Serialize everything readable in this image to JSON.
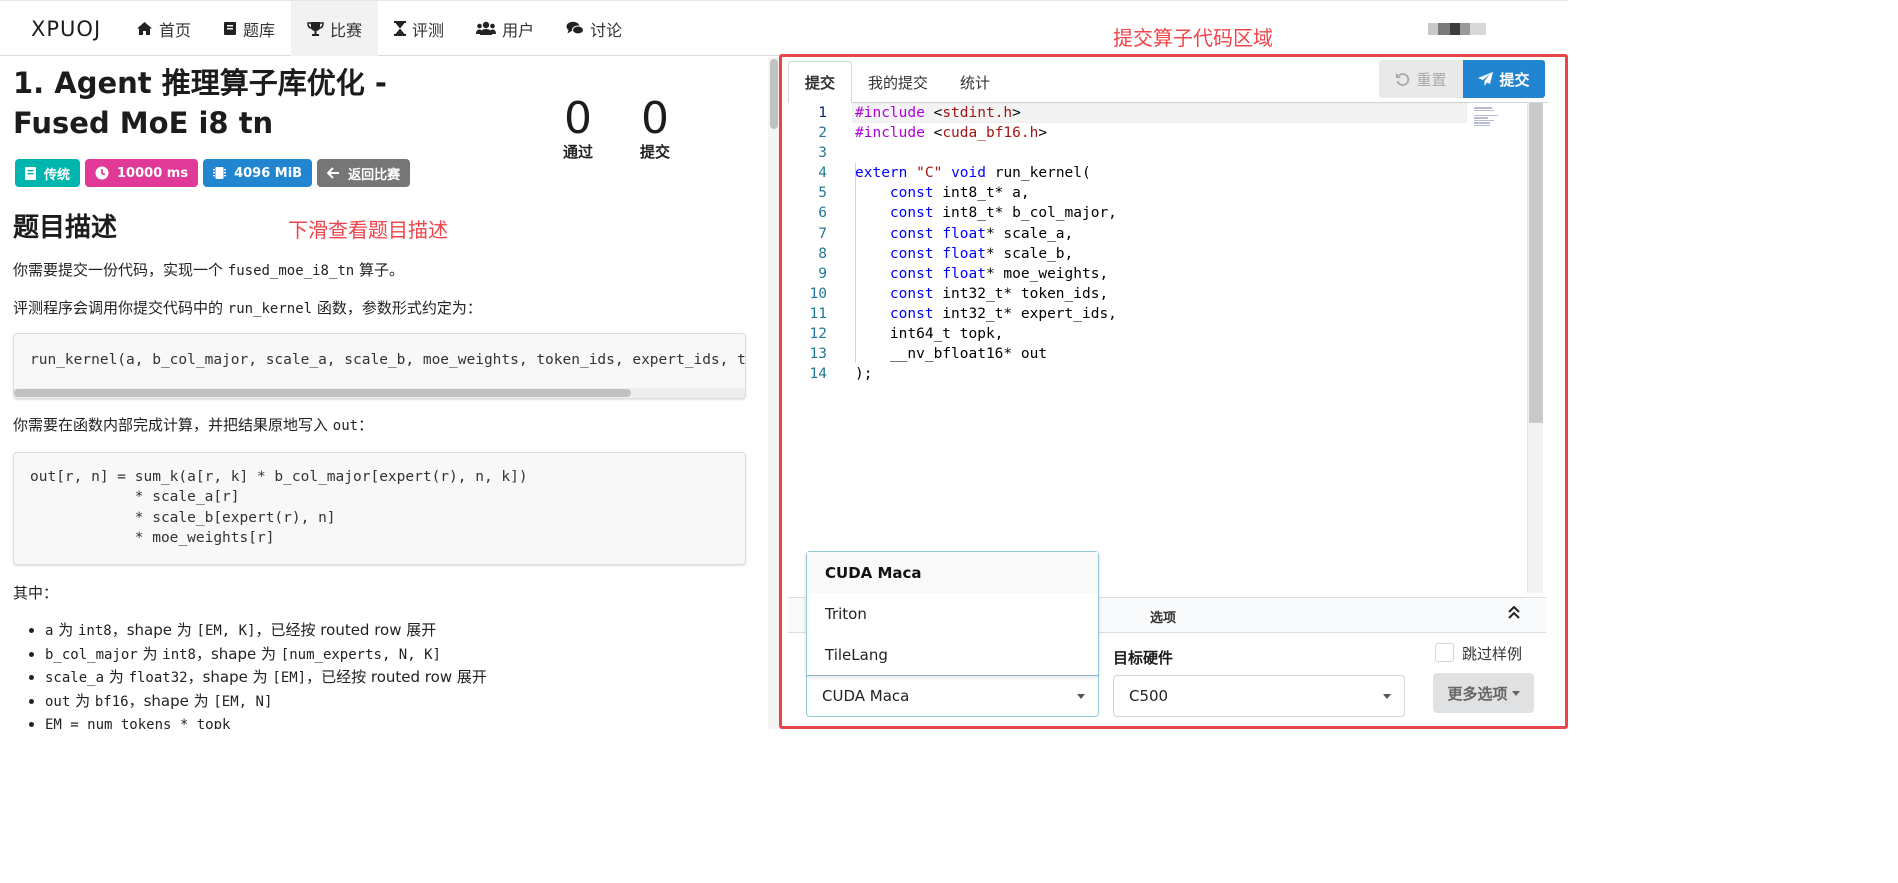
{
  "nav": {
    "brand": "XPUOJ",
    "items": [
      {
        "label": "首页",
        "icon": "home-icon"
      },
      {
        "label": "题库",
        "icon": "book-icon"
      },
      {
        "label": "比赛",
        "icon": "trophy-icon",
        "active": true
      },
      {
        "label": "评测",
        "icon": "hourglass-icon"
      },
      {
        "label": "用户",
        "icon": "users-icon"
      },
      {
        "label": "讨论",
        "icon": "comments-icon"
      }
    ]
  },
  "problem": {
    "title": "1. Agent 推理算子库优化 - Fused MoE i8 tn",
    "stats": {
      "passed_value": "0",
      "passed_label": "通过",
      "submitted_value": "0",
      "submitted_label": "提交"
    },
    "tags": {
      "type": "传统",
      "time_limit": "10000 ms",
      "memory_limit": "4096 MiB",
      "back": "返回比赛"
    },
    "section_title": "题目描述",
    "annotation_scroll": "下滑查看题目描述",
    "p1_a": "你需要提交一份代码，实现一个 ",
    "p1_code": "fused_moe_i8_tn",
    "p1_b": " 算子。",
    "p2_a": "评测程序会调用你提交代码中的 ",
    "p2_code": "run_kernel",
    "p2_b": " 函数，参数形式约定为：",
    "code1": "run_kernel(a, b_col_major, scale_a, scale_b, moe_weights, token_ids, expert_ids, topk, out)",
    "p3_a": "你需要在函数内部完成计算，并把结果原地写入 ",
    "p3_code": "out",
    "p3_b": "：",
    "code2": "out[r, n] = sum_k(a[r, k] * b_col_major[expert(r), n, k])\n            * scale_a[r]\n            * scale_b[expert(r), n]\n            * moe_weights[r]",
    "p4": "其中：",
    "bullets": [
      {
        "c1": "a",
        "t1": " 为 ",
        "c2": "int8",
        "t2": "，shape 为 ",
        "c3": "[EM, K]",
        "t3": "，已经按 routed row 展开"
      },
      {
        "c1": "b_col_major",
        "t1": " 为 ",
        "c2": "int8",
        "t2": "，shape 为 ",
        "c3": "[num_experts, N, K]",
        "t3": ""
      },
      {
        "c1": "scale_a",
        "t1": " 为 ",
        "c2": "float32",
        "t2": "，shape 为 ",
        "c3": "[EM]",
        "t3": "，已经按 routed row 展开"
      },
      {
        "c1": "out",
        "t1": " 为 ",
        "c2": "bf16",
        "t2": "，shape 为 ",
        "c3": "[EM, N]",
        "t3": ""
      },
      {
        "c1": "EM = num_tokens * topk",
        "t1": "",
        "c2": "",
        "t2": "",
        "c3": "",
        "t3": ""
      }
    ]
  },
  "submit_panel": {
    "annotation": "提交算子代码区域",
    "tabs": [
      "提交",
      "我的提交",
      "统计"
    ],
    "reset_label": "重置",
    "submit_label": "提交",
    "code_lines": [
      "#include <stdint.h>",
      "#include <cuda_bf16.h>",
      "",
      "extern \"C\" void run_kernel(",
      "    const int8_t* a,",
      "    const int8_t* b_col_major,",
      "    const float* scale_a,",
      "    const float* scale_b,",
      "    const float* moe_weights,",
      "    const int32_t* token_ids,",
      "    const int32_t* expert_ids,",
      "    int64_t topk,",
      "    __nv_bfloat16* out",
      ");"
    ],
    "line_numbers": [
      "1",
      "2",
      "3",
      "4",
      "5",
      "6",
      "7",
      "8",
      "9",
      "10",
      "11",
      "12",
      "13",
      "14"
    ],
    "options_label": "选项",
    "language": {
      "options": [
        "CUDA Maca",
        "Triton",
        "TileLang"
      ],
      "selected": "CUDA Maca"
    },
    "hardware": {
      "label": "目标硬件",
      "selected": "C500"
    },
    "skip_samples_label": "跳过样例",
    "more_options_label": "更多选项"
  },
  "colors": {
    "accent_blue": "#2185d0",
    "tag_teal": "#00b5ad",
    "tag_pink": "#e03997",
    "tag_blue": "#2185d0",
    "tag_grey": "#767676",
    "annotation_red": "#f0454a"
  }
}
